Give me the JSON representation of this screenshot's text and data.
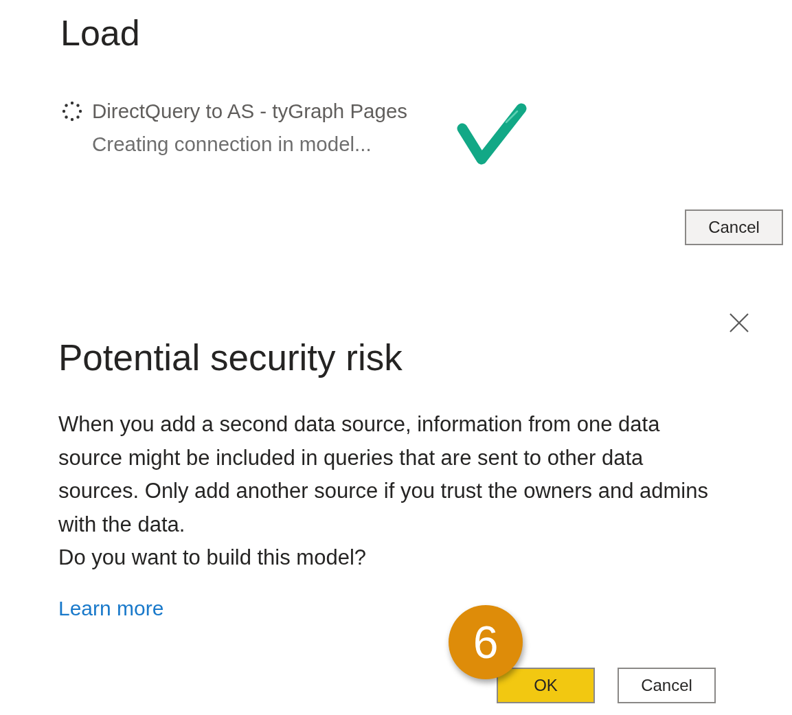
{
  "load": {
    "title": "Load",
    "items": [
      {
        "name": "DirectQuery to AS - tyGraph Pages",
        "status": "Creating connection in model...",
        "completed": true
      }
    ],
    "cancel_button": "Cancel"
  },
  "security_dialog": {
    "title": "Potential security risk",
    "message": "When you add a second data source, information from one data source might be included in queries that are sent to other data sources. Only add another source if you trust the owners and admins with the data.",
    "question": "Do you want to build this model?",
    "link": "Learn more",
    "buttons": [
      {
        "label": "OK",
        "kind": "primary"
      },
      {
        "label": "Cancel",
        "kind": "standard"
      }
    ]
  },
  "step_badge": "6"
}
